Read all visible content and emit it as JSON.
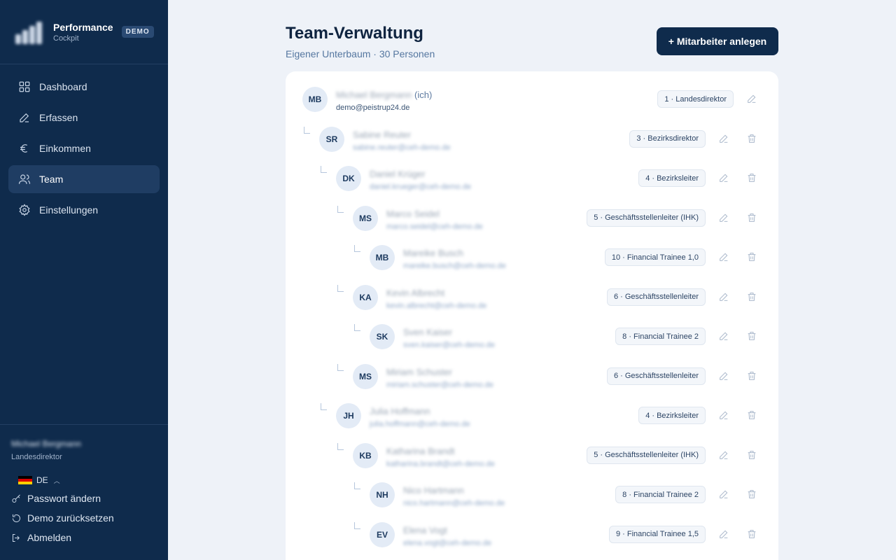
{
  "brand": {
    "title": "Performance",
    "subtitle": "Cockpit",
    "badge": "DEMO"
  },
  "nav": [
    {
      "label": "Dashboard",
      "icon": "grid-icon"
    },
    {
      "label": "Erfassen",
      "icon": "pen-icon"
    },
    {
      "label": "Einkommen",
      "icon": "euro-icon"
    },
    {
      "label": "Team",
      "icon": "users-icon",
      "active": true
    },
    {
      "label": "Einstellungen",
      "icon": "gear-icon"
    }
  ],
  "user": {
    "name": "Michael Bergmann",
    "role": "Landesdirektor"
  },
  "language": {
    "code": "DE",
    "flag_colors": [
      "#000000",
      "#dd0000",
      "#ffce00"
    ]
  },
  "footer_links": [
    {
      "label": "Passwort ändern",
      "icon": "key-icon"
    },
    {
      "label": "Demo zurücksetzen",
      "icon": "reset-icon"
    },
    {
      "label": "Abmelden",
      "icon": "logout-icon"
    }
  ],
  "page": {
    "title": "Team-Verwaltung",
    "subtitle": "Eigener Unterbaum · 30 Personen",
    "add_button": "+ Mitarbeiter anlegen"
  },
  "members": [
    {
      "initials": "MB",
      "name": "Michael Bergmann",
      "me_tag": "(ich)",
      "email": "demo@peistrup24.de",
      "role": "1 · Landesdirektor",
      "level": 0,
      "is_self": true
    },
    {
      "initials": "SR",
      "name": "Sabine Reuter",
      "email": "sabine.reuter@ceh-demo.de",
      "role": "3 · Bezirksdirektor",
      "level": 1
    },
    {
      "initials": "DK",
      "name": "Daniel Krüger",
      "email": "daniel.krueger@ceh-demo.de",
      "role": "4 · Bezirksleiter",
      "level": 2
    },
    {
      "initials": "MS",
      "name": "Marco Seidel",
      "email": "marco.seidel@ceh-demo.de",
      "role": "5 · Geschäftsstellenleiter (IHK)",
      "level": 3
    },
    {
      "initials": "MB",
      "name": "Mareike Busch",
      "email": "mareike.busch@ceh-demo.de",
      "role": "10 · Financial Trainee 1,0",
      "level": 4
    },
    {
      "initials": "KA",
      "name": "Kevin Albrecht",
      "email": "kevin.albrecht@ceh-demo.de",
      "role": "6 · Geschäftsstellenleiter",
      "level": 3
    },
    {
      "initials": "SK",
      "name": "Sven Kaiser",
      "email": "sven.kaiser@ceh-demo.de",
      "role": "8 · Financial Trainee 2",
      "level": 4
    },
    {
      "initials": "MS",
      "name": "Miriam Schuster",
      "email": "miriam.schuster@ceh-demo.de",
      "role": "6 · Geschäftsstellenleiter",
      "level": 3
    },
    {
      "initials": "JH",
      "name": "Julia Hoffmann",
      "email": "julia.hoffmann@ceh-demo.de",
      "role": "4 · Bezirksleiter",
      "level": 2
    },
    {
      "initials": "KB",
      "name": "Katharina Brandt",
      "email": "katharina.brandt@ceh-demo.de",
      "role": "5 · Geschäftsstellenleiter (IHK)",
      "level": 3
    },
    {
      "initials": "NH",
      "name": "Nico Hartmann",
      "email": "nico.hartmann@ceh-demo.de",
      "role": "8 · Financial Trainee 2",
      "level": 4
    },
    {
      "initials": "EV",
      "name": "Elena Vogt",
      "email": "elena.vogt@ceh-demo.de",
      "role": "9 · Financial Trainee 1,5",
      "level": 4
    }
  ]
}
